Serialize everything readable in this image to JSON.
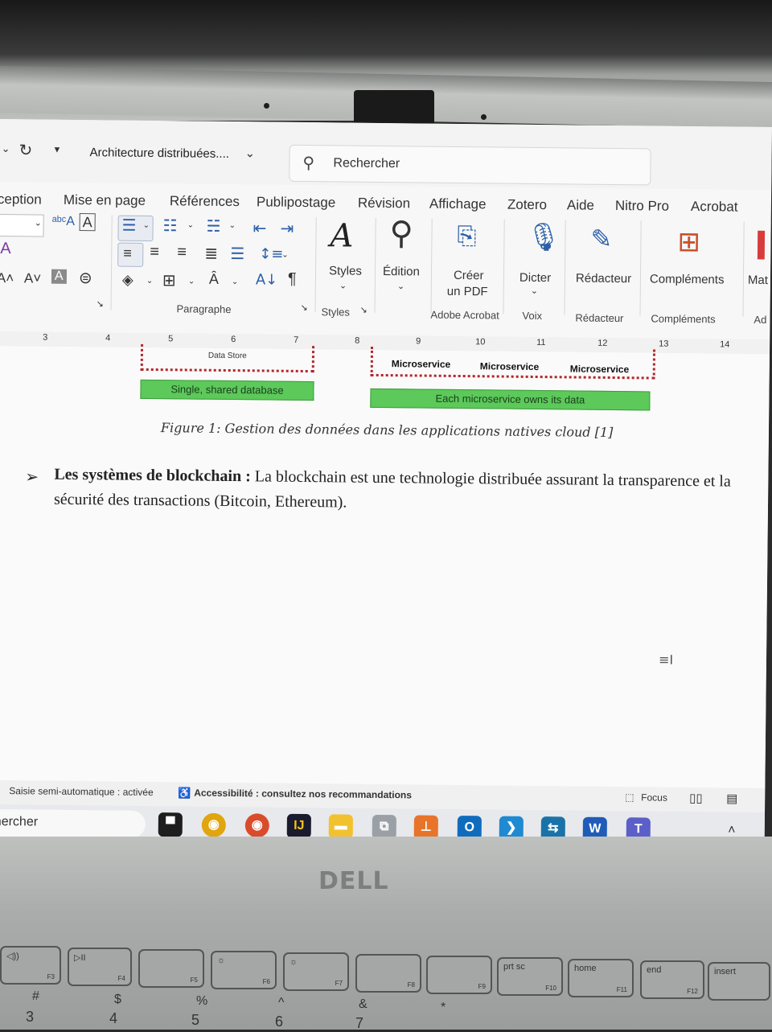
{
  "word": {
    "doc_title": "Architecture distribuées....",
    "search_placeholder": "Rechercher",
    "tabs": [
      "ception",
      "Mise en page",
      "Références",
      "Publipostage",
      "Révision",
      "Affichage",
      "Zotero",
      "Aide",
      "Nitro Pro",
      "Acrobat"
    ],
    "ribbon": {
      "group_paragraph": "Paragraphe",
      "group_styles": "Styles",
      "styles_button": "Styles",
      "edition_button": "Édition",
      "create_pdf": "Créer",
      "create_pdf_line2": "un PDF",
      "group_adobe": "Adobe Acrobat",
      "dictate": "Dicter",
      "group_voice": "Voix",
      "editor": "Rédacteur",
      "group_editor": "Rédacteur",
      "addins": "Compléments",
      "group_addins": "Compléments",
      "cut_off_button": "Mat",
      "cut_off_group": "Ad"
    },
    "ruler_numbers": [
      "3",
      "4",
      "5",
      "6",
      "7",
      "8",
      "9",
      "10",
      "11",
      "12",
      "13",
      "14"
    ]
  },
  "document": {
    "figure": {
      "data_store": "Data Store",
      "single_db": "Single, shared database",
      "microservices": [
        "Microservice",
        "Microservice",
        "Microservice"
      ],
      "own_data": "Each microservice owns its data"
    },
    "caption": "Figure 1: Gestion des données dans les applications natives cloud [1]",
    "bullet_bold": "Les systèmes de blockchain :",
    "bullet_text": " La blockchain est une technologie distribuée assurant la transparence et la sécurité des transactions (Bitcoin, Ethereum)."
  },
  "status_bar": {
    "autosave": "Saisie semi-automatique : activée",
    "accessibility": "Accessibilité : consultez nos recommandations",
    "focus": "Focus"
  },
  "taskbar": {
    "search_text": "hercher"
  },
  "laptop": {
    "brand": "DELL",
    "fkeys": [
      {
        "top": "◁))",
        "sub": "F3"
      },
      {
        "top": "▷II",
        "sub": "F4"
      },
      {
        "top": "",
        "sub": "F5"
      },
      {
        "top": "☼",
        "sub": "F6"
      },
      {
        "top": "☼",
        "sub": "F7"
      },
      {
        "top": "",
        "sub": "F8"
      },
      {
        "top": "",
        "sub": "F9"
      },
      {
        "top": "prt sc",
        "sub": "F10"
      },
      {
        "top": "home",
        "sub": "F11"
      },
      {
        "top": "end",
        "sub": "F12"
      },
      {
        "top": "insert",
        "sub": ""
      }
    ],
    "number_keys": [
      "#",
      "3",
      "$",
      "4",
      "%",
      "5",
      "^",
      "6",
      "&",
      "7",
      "*"
    ]
  }
}
